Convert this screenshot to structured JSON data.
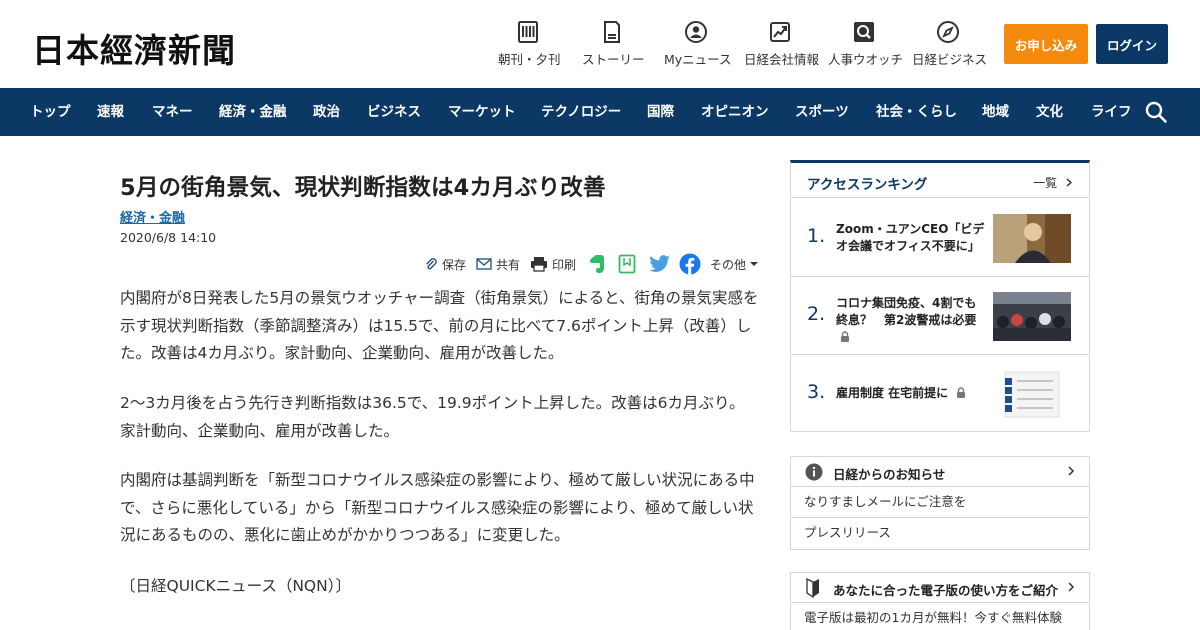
{
  "header": {
    "logo": "日本經濟新聞",
    "services": [
      {
        "label": "朝刊・夕刊",
        "icon": "newspaper-icon"
      },
      {
        "label": "ストーリー",
        "icon": "document-icon"
      },
      {
        "label": "Myニュース",
        "icon": "user-icon"
      },
      {
        "label": "日経会社情報",
        "icon": "stock-chart-icon"
      },
      {
        "label": "人事ウオッチ",
        "icon": "magnifier-person-icon"
      },
      {
        "label": "日経ビジネス",
        "icon": "compass-icon"
      }
    ],
    "apply_label": "お申し込み",
    "login_label": "ログイン"
  },
  "nav": {
    "items": [
      "トップ",
      "速報",
      "マネー",
      "経済・金融",
      "政治",
      "ビジネス",
      "マーケット",
      "テクノロジー",
      "国際",
      "オピニオン",
      "スポーツ",
      "社会・くらし",
      "地域",
      "文化",
      "ライフ"
    ],
    "search_icon": "search-icon"
  },
  "article": {
    "title": "5月の街角景気、現状判断指数は4カ月ぶり改善",
    "category": "経済・金融",
    "date": "2020/6/8 14:10",
    "tools": {
      "save": "保存",
      "share": "共有",
      "print": "印刷",
      "more": "その他"
    },
    "paragraphs": [
      "内閣府が8日発表した5月の景気ウオッチャー調査（街角景気）によると、街角の景気実感を示す現状判断指数（季節調整済み）は15.5で、前の月に比べて7.6ポイント上昇（改善）した。改善は4カ月ぶり。家計動向、企業動向、雇用が改善した。",
      "2～3カ月後を占う先行き判断指数は36.5で、19.9ポイント上昇した。改善は6カ月ぶり。家計動向、企業動向、雇用が改善した。",
      "内閣府は基調判断を「新型コロナウイルス感染症の影響により、極めて厳しい状況にある中で、さらに悪化している」から「新型コロナウイルス感染症の影響により、極めて厳しい状況にあるものの、悪化に歯止めがかかりつつある」に変更した。",
      "〔日経QUICKニュース（NQN）〕"
    ]
  },
  "ranking": {
    "title": "アクセスランキング",
    "more": "一覧",
    "items": [
      {
        "rank": "1.",
        "text": "Zoom・ユアンCEO「ビデオ会議でオフィス不要に」"
      },
      {
        "rank": "2.",
        "text": "コロナ集団免疫、4割でも終息？　第2波警戒は必要"
      },
      {
        "rank": "3.",
        "text": "雇用制度 在宅前提に"
      }
    ]
  },
  "notice": {
    "title": "日経からのお知らせ",
    "rows": [
      "なりすましメールにご注意を",
      "プレスリリース"
    ]
  },
  "guide": {
    "title": "あなたに合った電子版の使い方をご紹介",
    "rows": [
      "電子版は最初の1カ月が無料！今すぐ無料体験"
    ]
  },
  "colors": {
    "navy": "#0b3865",
    "orange": "#f58a0c",
    "link": "#1a6aa6"
  }
}
